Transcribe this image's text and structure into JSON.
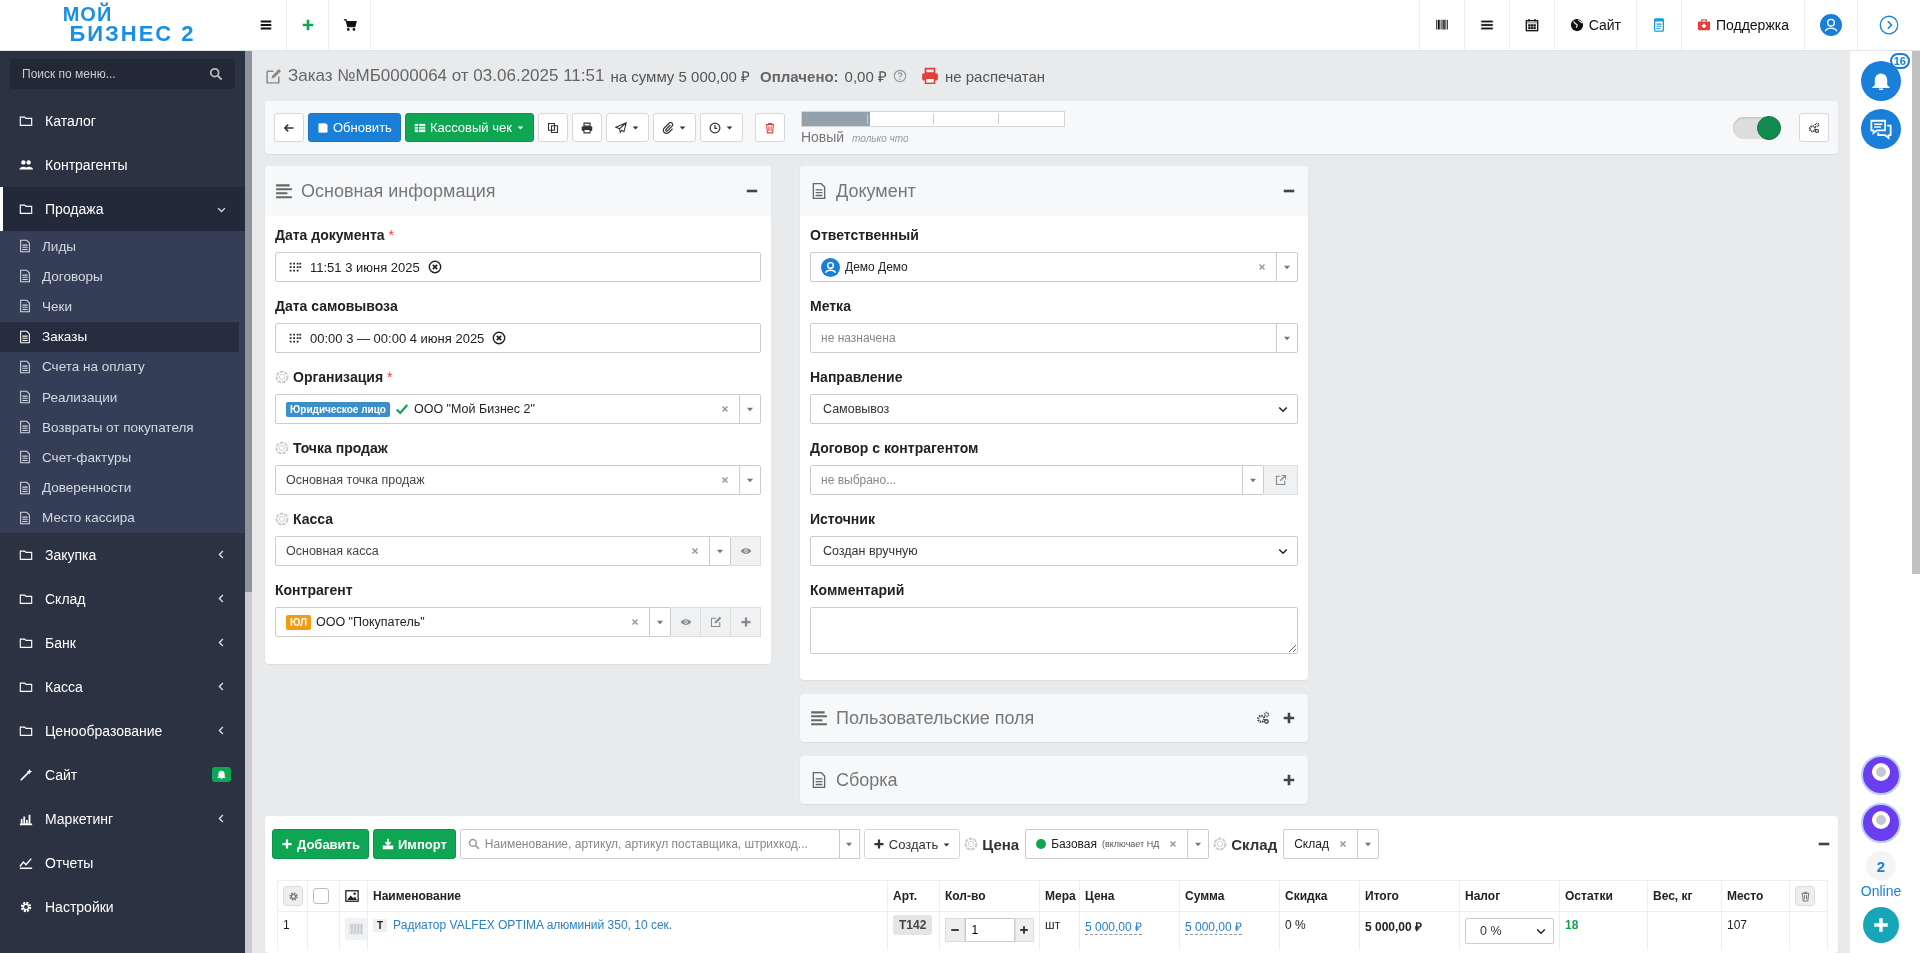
{
  "logo": {
    "top": "МОЙ",
    "bottom": "БИЗНЕС 2"
  },
  "topbar": {
    "site": "Сайт",
    "support": "Поддержка"
  },
  "sidebar": {
    "search_placeholder": "Поиск по меню...",
    "items": [
      {
        "label": "Каталог",
        "kind": "folder",
        "selected": false,
        "alert": false
      },
      {
        "label": "Контрагенты",
        "kind": "link",
        "selected": false,
        "alert": false
      },
      {
        "label": "Продажа",
        "kind": "folder",
        "expanded": true,
        "selected": true,
        "alert": false,
        "children": [
          {
            "label": "Лиды",
            "selected": false
          },
          {
            "label": "Договоры",
            "selected": false
          },
          {
            "label": "Чеки",
            "selected": false
          },
          {
            "label": "Заказы",
            "selected": true
          },
          {
            "label": "Счета на оплату",
            "selected": false
          },
          {
            "label": "Реализации",
            "selected": false
          },
          {
            "label": "Возвраты от покупателя",
            "selected": false
          },
          {
            "label": "Счет-фактуры",
            "selected": false
          },
          {
            "label": "Доверенности",
            "selected": false
          },
          {
            "label": "Место кассира",
            "selected": false
          }
        ]
      },
      {
        "label": "Закупка",
        "kind": "folder",
        "expanded": false,
        "selected": false,
        "alert": false
      },
      {
        "label": "Склад",
        "kind": "folder",
        "expanded": false,
        "selected": false,
        "alert": false
      },
      {
        "label": "Банк",
        "kind": "folder",
        "expanded": false,
        "selected": false,
        "alert": false
      },
      {
        "label": "Касса",
        "kind": "folder",
        "expanded": false,
        "selected": false,
        "alert": false
      },
      {
        "label": "Ценообразование",
        "kind": "folder",
        "expanded": false,
        "selected": false,
        "alert": false
      },
      {
        "label": "Сайт",
        "kind": "link",
        "selected": false,
        "alert": true
      },
      {
        "label": "Маркетинг",
        "kind": "link",
        "expanded": false,
        "selected": false,
        "alert": false
      },
      {
        "label": "Отчеты",
        "kind": "link",
        "selected": false,
        "alert": false
      },
      {
        "label": "Настройки",
        "kind": "link",
        "selected": false,
        "alert": false
      }
    ]
  },
  "order_header": {
    "title": "Заказ №МБ0000064 от 03.06.2025 11:51",
    "amount": "на сумму 5 000,00 ₽",
    "paid_label": "Оплачено:",
    "paid": "0,00 ₽",
    "print_status": "не распечатан"
  },
  "toolbar": {
    "save": "Обновить",
    "receipt": "Кассовый чек",
    "status": {
      "level": 0.26,
      "label": "Новый",
      "time": "только что"
    },
    "toggle_on": true
  },
  "main_info": {
    "title": "Основная информация",
    "fields": [
      {
        "kind": "date",
        "label": "Дата документа",
        "required": "*",
        "hint_icon": false,
        "value": "11:51 3 июня 2025"
      },
      {
        "kind": "date",
        "label": "Дата самовывоза",
        "hint_icon": false,
        "value": "00:00 3 — 00:00 4 июня 2025"
      },
      {
        "kind": "select",
        "label": "Организация",
        "required": "*",
        "hint_icon": true,
        "tag": {
          "text": "Юридическое лицо",
          "color": "#3a8fc8"
        },
        "verified": true,
        "value": "ООО \"Мой Бизнес 2\""
      },
      {
        "kind": "select",
        "label": "Точка продаж",
        "hint_icon": true,
        "verified": false,
        "value": "Основная точка продаж"
      },
      {
        "kind": "select",
        "label": "Касса",
        "hint_icon": true,
        "verified": false,
        "value": "Основная касса",
        "addons": [
          {
            "kind": "view"
          }
        ]
      },
      {
        "kind": "select",
        "label": "Контрагент",
        "hint_icon": false,
        "tag": {
          "text": "ЮЛ",
          "color": "#f39c12"
        },
        "verified": false,
        "value": "ООО \"Покупатель\"",
        "addons": [
          {
            "kind": "view"
          },
          {
            "kind": "edit"
          },
          {
            "kind": "add"
          }
        ]
      }
    ]
  },
  "document": {
    "title": "Документ",
    "fields": [
      {
        "kind": "person",
        "label": "Ответственный",
        "value": "Демо Демо"
      },
      {
        "kind": "combo",
        "label": "Метка",
        "placeholder": "не назначена"
      },
      {
        "kind": "native",
        "label": "Направление",
        "value": "Самовывоз"
      },
      {
        "kind": "combo",
        "label": "Договор с контрагентом",
        "placeholder": "не выбрано...",
        "addons": [
          {
            "kind": "open"
          }
        ]
      },
      {
        "kind": "native",
        "label": "Источник",
        "value": "Создан вручную"
      },
      {
        "kind": "textarea",
        "label": "Комментарий"
      }
    ]
  },
  "panels": [
    {
      "title": "Пользовательские поля",
      "kind": "list",
      "settings": true
    },
    {
      "title": "Сборка",
      "kind": "doc",
      "settings": false
    }
  ],
  "items": {
    "add": "Добавить",
    "import": "Импорт",
    "search_placeholder": "Наименование, артикул, артикул поставщика, штрихкод...",
    "create": "Создать",
    "price_label": "Цена",
    "price": {
      "name": "Базовая",
      "note": "(включает НД",
      "color": "#0ea653"
    },
    "warehouse_label": "Склад",
    "warehouse": "Склад",
    "select_all_checked": false,
    "columns": [
      "Наименование",
      "Арт.",
      "Кол-во",
      "Мера",
      "Цена",
      "Сумма",
      "Скидка",
      "Итого",
      "Налог",
      "Остатки",
      "Вес, кг",
      "Место"
    ],
    "rows": [
      {
        "index": "1",
        "type": "Т",
        "name": "Радиатор VALFEX OPTIMA алюминий 350, 10 сек.",
        "article": "Т142",
        "qty": "1",
        "unit": "шт",
        "price": "5 000,00 ₽",
        "sum": "5 000,00 ₽",
        "discount": "0 %",
        "total": "5 000,00 ₽",
        "tax": "0 %",
        "stock": "18",
        "place": "107"
      }
    ]
  },
  "rail": {
    "notifications": "16",
    "online_count": "2",
    "online_label": "Online"
  }
}
